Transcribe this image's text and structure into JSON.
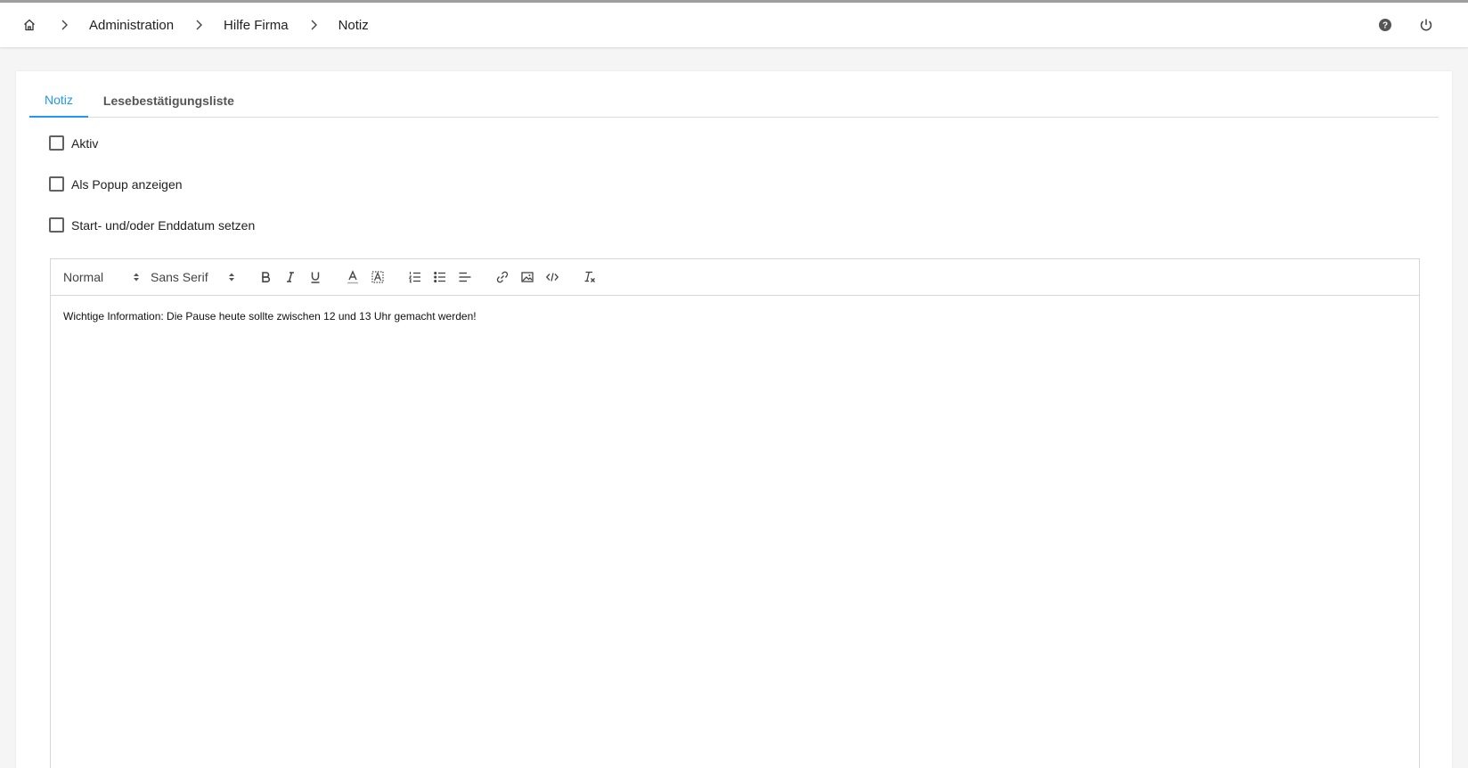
{
  "breadcrumb": {
    "home_icon": "home-icon",
    "separator_icon": "chevron-right-icon",
    "items": [
      "Administration",
      "Hilfe Firma",
      "Notiz"
    ]
  },
  "header": {
    "help_icon": "help-circle-icon",
    "power_icon": "power-icon"
  },
  "tabs": [
    {
      "label": "Notiz",
      "active": true
    },
    {
      "label": "Lesebestätigungsliste",
      "active": false
    }
  ],
  "options": [
    {
      "label": "Aktiv",
      "checked": false
    },
    {
      "label": "Als Popup anzeigen",
      "checked": false
    },
    {
      "label": "Start- und/oder Enddatum setzen",
      "checked": false
    }
  ],
  "editor": {
    "toolbar": {
      "format_value": "Normal",
      "font_value": "Sans Serif",
      "buttons": [
        "bold-icon",
        "italic-icon",
        "underline-icon",
        "text-color-icon",
        "background-color-icon",
        "ordered-list-icon",
        "bullet-list-icon",
        "align-icon",
        "link-icon",
        "image-icon",
        "code-icon",
        "clear-format-icon"
      ]
    },
    "content": "Wichtige Information: Die Pause heute sollte zwischen 12 und 13 Uhr gemacht werden!"
  },
  "colors": {
    "accent": "#2196f3",
    "text": "#212121",
    "border": "#d6d6d6"
  }
}
